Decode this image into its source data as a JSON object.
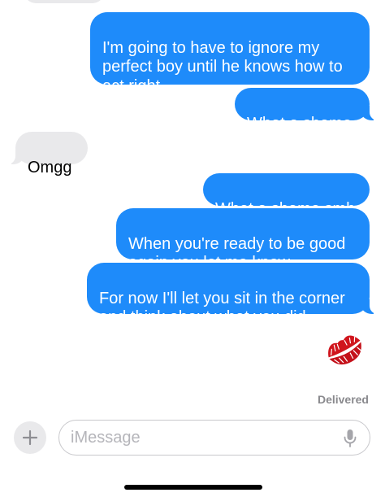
{
  "messages": [
    {
      "direction": "outgoing",
      "text": "I'm going to have to ignore my\nperfect boy until he knows how to\nact right"
    },
    {
      "direction": "outgoing",
      "text": "What a shame"
    },
    {
      "direction": "incoming",
      "text": "Omgg"
    },
    {
      "direction": "outgoing",
      "text": "What a shame smh"
    },
    {
      "direction": "outgoing",
      "text": "When you're ready to be good\nagain you let me know"
    },
    {
      "direction": "outgoing",
      "text": "For now I'll let you sit in the corner\nand think about what you did"
    },
    {
      "direction": "outgoing",
      "emoji_name": "kiss-mark-icon"
    }
  ],
  "status": {
    "delivered_label": "Delivered"
  },
  "composer": {
    "placeholder": "iMessage",
    "value": "",
    "plus_icon": "plus-icon",
    "mic_icon": "microphone-icon"
  },
  "colors": {
    "outgoing_bubble": "#1e8bfa",
    "incoming_bubble": "#e9e9eb",
    "status_text": "#8a8a8e"
  }
}
